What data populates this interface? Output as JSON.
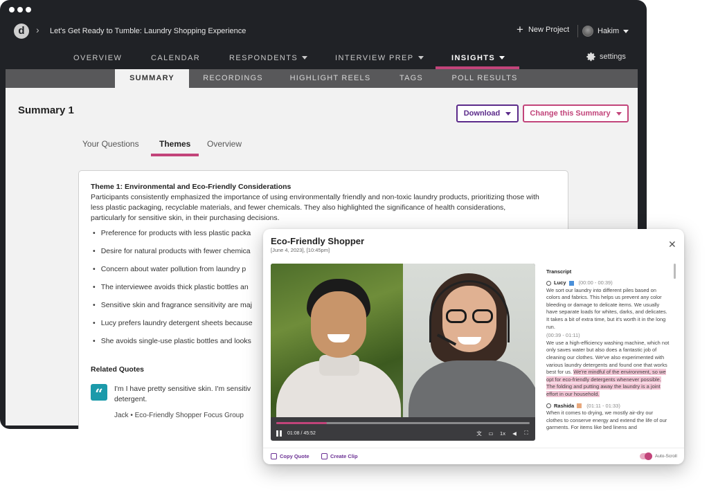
{
  "colors": {
    "accent": "#c2447a",
    "purple": "#5b2a8a",
    "dark_bg": "#202226",
    "subnav_bg": "#58585a",
    "content_bg": "#f2f2f2",
    "quote_teal": "#1b9aaa"
  },
  "header": {
    "logo_letter": "d",
    "project_title": "Let's Get Ready to Tumble: Laundry Shopping Experience",
    "new_project": "New Project",
    "user_name": "Hakim",
    "settings": "settings"
  },
  "main_nav": [
    "OVERVIEW",
    "CALENDAR",
    "RESPONDENTS",
    "INTERVIEW PREP",
    "INSIGHTS"
  ],
  "sub_nav": [
    "SUMMARY",
    "RECORDINGS",
    "HIGHLIGHT REELS",
    "TAGS",
    "POLL RESULTS"
  ],
  "summary": {
    "title": "Summary 1",
    "download": "Download",
    "change": "Change this Summary",
    "tabs": [
      "Your Questions",
      "Themes",
      "Overview"
    ]
  },
  "theme": {
    "title": "Theme 1: Environmental and Eco-Friendly Considerations",
    "description": "Participants consistently emphasized the importance of using environmentally friendly and non-toxic laundry products, prioritizing those with less plastic packaging, recyclable materials, and fewer chemicals. They also highlighted the significance of health considerations, particularly for sensitive skin, in their purchasing decisions.",
    "bullets": [
      "Preference for products with less plastic packa",
      "Desire for natural products with fewer chemica",
      "Concern about water pollution from laundry p",
      "The interviewee avoids thick plastic bottles an",
      "Sensitive skin and fragrance sensitivity are maj",
      "Lucy prefers laundry detergent sheets because",
      "She avoids single-use plastic bottles and looks"
    ],
    "related_quotes_title": "Related Quotes",
    "quote_text": "I'm I have pretty sensitive skin. I'm sensitiv detergent.",
    "quote_source": "Jack  •  Eco-Friendly Shopper Focus Group"
  },
  "modal": {
    "title": "Eco-Friendly Shopper",
    "date": "[June 4, 2023], [10:45pm]",
    "close": "✕",
    "time": "01:08 / 45:52",
    "progress": 0.2,
    "speed": "1x",
    "transcript_heading": "Transcript",
    "speaker1": {
      "name": "Lucy",
      "time": "(00:00 - 00:39)",
      "color": "#4a90d9"
    },
    "para1": "We sort our laundry into different piles based on colors and fabrics. This helps us prevent any color bleeding or damage to delicate items. We usually have separate loads for whites, darks, and delicates. It takes a bit of extra time, but it's worth it in the long run.",
    "time2": "(00:39 - 01:11)",
    "para2_plain": "We use a high-efficiency washing machine, which not only saves water but also does a fantastic job of cleaning our clothes. We've also experimented with various laundry detergents and found one that works best for us. ",
    "para2_highlight": "We're mindful of the environment, so we opt for eco-friendly detergents whenever possible. The folding and putting away the laundry is a joint effort in our household.",
    "speaker2": {
      "name": "Rashida",
      "time": "(01:11 - 01:33)",
      "color": "#e8a87c"
    },
    "para3": "When it comes to drying, we mostly air-dry our clothes to conserve energy and extend the life of our garments. For items like bed linens and",
    "copy_quote": "Copy Quote",
    "create_clip": "Create Clip",
    "auto_scroll": "Auto-Scroll"
  }
}
